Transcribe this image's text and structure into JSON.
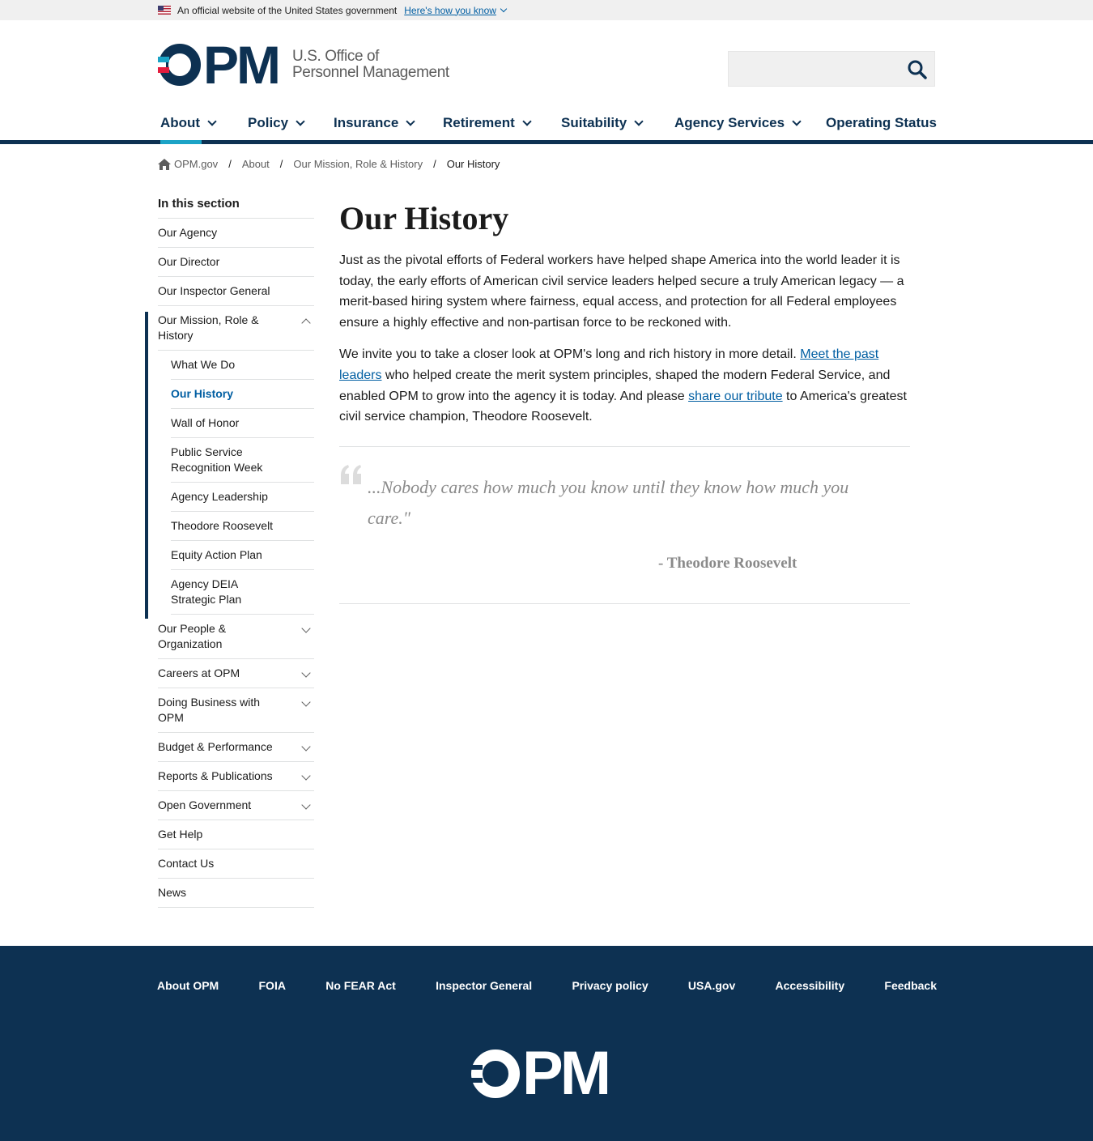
{
  "gov_banner": {
    "text": "An official website of the United States government",
    "link": "Here's how you know"
  },
  "header": {
    "logo_letters": "PM",
    "logo_line1": "U.S. Office of",
    "logo_line2": "Personnel Management",
    "search": {
      "placeholder": "",
      "value": ""
    }
  },
  "nav": {
    "items": [
      {
        "label": "About"
      },
      {
        "label": "Policy"
      },
      {
        "label": "Insurance"
      },
      {
        "label": "Retirement"
      },
      {
        "label": "Suitability"
      },
      {
        "label": "Agency Services"
      },
      {
        "label": "Operating Status"
      }
    ],
    "active": "About"
  },
  "breadcrumb": {
    "home": "OPM.gov",
    "items": [
      "About",
      "Our Mission, Role & History"
    ],
    "current": "Our History"
  },
  "sidebar": {
    "heading": "In this section",
    "items": [
      {
        "label": "Our Agency"
      },
      {
        "label": "Our Director"
      },
      {
        "label": "Our Inspector General"
      },
      {
        "label": "Our Mission, Role & History"
      },
      {
        "label": "Our People & Organization"
      },
      {
        "label": "Careers at OPM"
      },
      {
        "label": "Doing Business with OPM"
      },
      {
        "label": "Budget & Performance"
      },
      {
        "label": "Reports & Publications"
      },
      {
        "label": "Open Government"
      },
      {
        "label": "Get Help"
      },
      {
        "label": "Contact Us"
      },
      {
        "label": "News"
      }
    ],
    "subitems": [
      {
        "label": "What We Do"
      },
      {
        "label": "Our History"
      },
      {
        "label": "Wall of Honor"
      },
      {
        "label": "Public Service Recognition Week"
      },
      {
        "label": "Agency Leadership"
      },
      {
        "label": "Theodore Roosevelt"
      },
      {
        "label": "Equity Action Plan"
      },
      {
        "label": "Agency DEIA Strategic Plan"
      }
    ]
  },
  "main": {
    "title": "Our History",
    "para1": "Just as the pivotal efforts of Federal workers have helped shape America into the world leader it is today, the early efforts of American civil service leaders helped secure a truly American legacy — a merit-based hiring system where fairness, equal access, and protection for all Federal employees ensure a highly effective and non-partisan force to be reckoned with.",
    "para2_a": "We invite you to take a closer look at OPM's long and rich history in more detail. ",
    "para2_link1": "Meet the past leaders",
    "para2_b": " who helped create the merit system principles, shaped the modern Federal Service, and enabled OPM to grow into the agency it is today. And please ",
    "para2_link2": "share our tribute",
    "para2_c": " to America's greatest civil service champion, Theodore Roosevelt.",
    "quote": "...Nobody cares how much you know until they know how much you care.\"",
    "quote_author": "- Theodore Roosevelt"
  },
  "footer": {
    "links": [
      {
        "label": "About OPM"
      },
      {
        "label": "FOIA"
      },
      {
        "label": "No FEAR Act"
      },
      {
        "label": "Inspector General"
      },
      {
        "label": "Privacy policy"
      },
      {
        "label": "USA.gov"
      },
      {
        "label": "Accessibility"
      },
      {
        "label": "Feedback"
      }
    ],
    "logo_letters": "PM"
  },
  "colors": {
    "navy": "#0d3152",
    "accent_teal": "#1ba3c6",
    "link_blue": "#005ea2",
    "brand_red": "#e31c3d"
  }
}
